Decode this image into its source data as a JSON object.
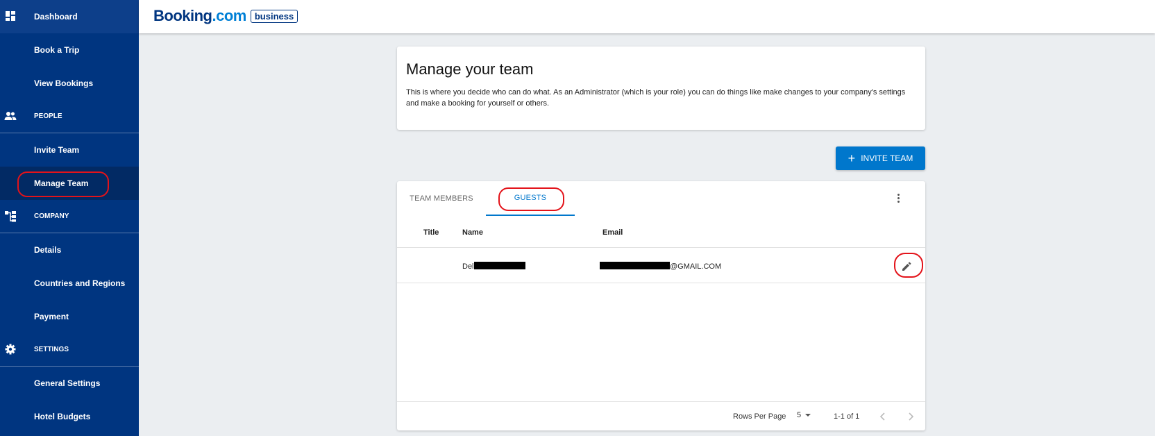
{
  "brand": {
    "name": "Booking",
    "domain": ".com",
    "badge": "business"
  },
  "sidebar": {
    "items": [
      {
        "label": "Dashboard",
        "icon": "dashboard-icon"
      },
      {
        "label": "Book a Trip"
      },
      {
        "label": "View Bookings"
      },
      {
        "label": "PEOPLE",
        "icon": "people-icon",
        "section": true
      },
      {
        "label": "Invite Team"
      },
      {
        "label": "Manage Team",
        "active": true
      },
      {
        "label": "COMPANY",
        "icon": "company-icon",
        "section": true
      },
      {
        "label": "Details"
      },
      {
        "label": "Countries and Regions"
      },
      {
        "label": "Payment"
      },
      {
        "label": "SETTINGS",
        "icon": "gear-icon",
        "section": true
      },
      {
        "label": "General Settings"
      },
      {
        "label": "Hotel Budgets"
      }
    ]
  },
  "intro": {
    "title": "Manage your team",
    "description": "This is where you decide who can do what. As an Administrator (which is your role) you can do things like make changes to your company's settings and make a booking for yourself or others."
  },
  "invite_button": {
    "label": "INVITE TEAM",
    "icon": "plus-icon"
  },
  "tabs": [
    {
      "label": "TEAM MEMBERS",
      "active": false
    },
    {
      "label": "GUESTS",
      "active": true
    }
  ],
  "table": {
    "columns": [
      "Title",
      "Name",
      "Email"
    ],
    "rows": [
      {
        "title": "",
        "name_visible": "Del",
        "email_visible": "@GMAIL.COM"
      }
    ]
  },
  "pagination": {
    "rows_per_page_label": "Rows Per Page",
    "rows_per_page": "5",
    "range": "1-1 of 1"
  },
  "colors": {
    "sidebar": "#003580",
    "accent": "#0077cc",
    "annotation": "#e3131a"
  }
}
